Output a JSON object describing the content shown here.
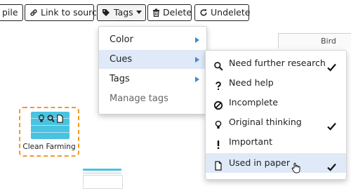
{
  "toolbar": {
    "pile_label": "pile",
    "link_label": "Link to source",
    "tags_label": "Tags",
    "delete_label": "Delete",
    "undelete_label": "Undelete"
  },
  "right_panel": {
    "column_label": "Bird"
  },
  "tags_menu": {
    "items": [
      {
        "label": "Color",
        "has_submenu": true
      },
      {
        "label": "Cues",
        "has_submenu": true,
        "active": true
      },
      {
        "label": "Tags",
        "has_submenu": true
      },
      {
        "label": "Manage tags",
        "has_submenu": false
      }
    ]
  },
  "cues_menu": {
    "items": [
      {
        "label": "Need further research",
        "icon": "search-icon",
        "checked": true
      },
      {
        "label": "Need help",
        "icon": "question-icon",
        "checked": false
      },
      {
        "label": "Incomplete",
        "icon": "ban-icon",
        "checked": false
      },
      {
        "label": "Original thinking",
        "icon": "lightbulb-icon",
        "checked": true
      },
      {
        "label": "Important",
        "icon": "exclamation-icon",
        "checked": false
      },
      {
        "label": "Used in paper",
        "icon": "document-icon",
        "checked": true,
        "hovered": true
      }
    ]
  },
  "canvas": {
    "node": {
      "label": "Clean Farming",
      "card_color": "#49c3df",
      "selection_color": "#f19b27"
    }
  },
  "colors": {
    "highlight": "#dfe9f7",
    "submenu_arrow": "#3a8ad8"
  }
}
